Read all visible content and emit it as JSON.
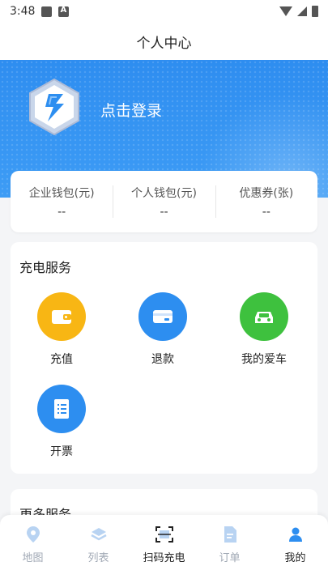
{
  "status_bar": {
    "time": "3:48"
  },
  "title": "个人中心",
  "login": {
    "label": "点击登录"
  },
  "wallet": [
    {
      "label": "企业钱包(元)",
      "value": "--"
    },
    {
      "label": "个人钱包(元)",
      "value": "--"
    },
    {
      "label": "优惠券(张)",
      "value": "--"
    }
  ],
  "charging_services": {
    "title": "充电服务",
    "items": [
      {
        "label": "充值",
        "icon": "wallet-icon",
        "color": "#f8b614"
      },
      {
        "label": "退款",
        "icon": "card-icon",
        "color": "#2d8ef0"
      },
      {
        "label": "我的爱车",
        "icon": "car-icon",
        "color": "#3ec13e"
      },
      {
        "label": "开票",
        "icon": "invoice-icon",
        "color": "#2d8ef0"
      }
    ]
  },
  "more_services": {
    "title": "更多服务"
  },
  "bottom_nav": {
    "items": [
      {
        "label": "地图",
        "icon": "map-pin-icon"
      },
      {
        "label": "列表",
        "icon": "layers-icon"
      },
      {
        "label": "扫码充电",
        "icon": "scan-icon"
      },
      {
        "label": "订单",
        "icon": "document-icon"
      },
      {
        "label": "我的",
        "icon": "user-icon"
      }
    ],
    "active": "我的"
  },
  "colors": {
    "accent": "#2d8ef0",
    "header_blue": "#3a98f3"
  }
}
